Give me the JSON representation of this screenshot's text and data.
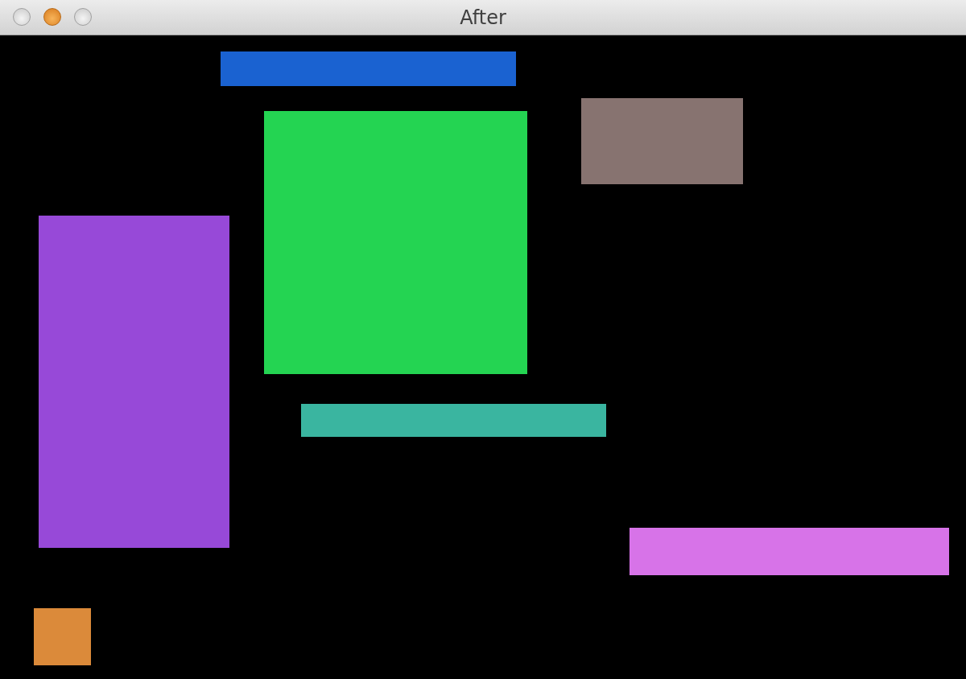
{
  "window": {
    "title": "After"
  },
  "rectangles": [
    {
      "color": "#1a62d1"
    },
    {
      "color": "#24d452"
    },
    {
      "color": "#877370"
    },
    {
      "color": "#9749d8"
    },
    {
      "color": "#3ab5a0"
    },
    {
      "color": "#d773e8"
    },
    {
      "color": "#db8a3a"
    }
  ]
}
